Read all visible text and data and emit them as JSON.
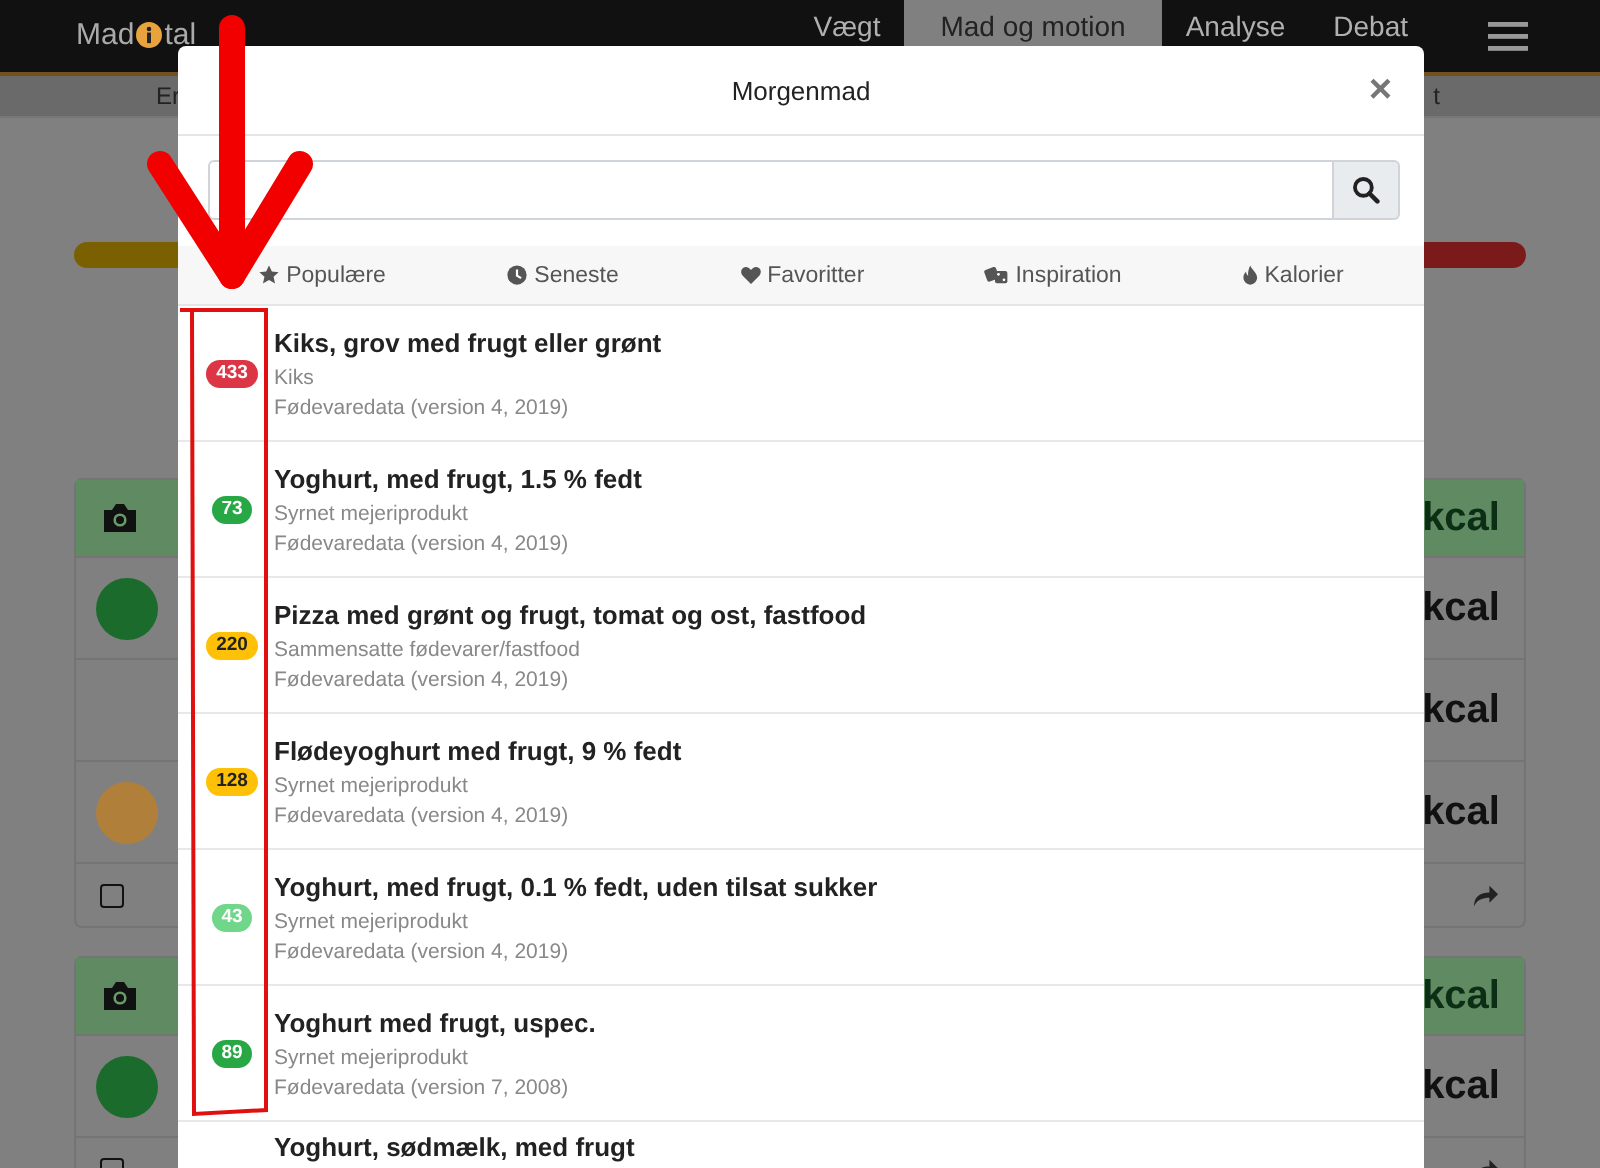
{
  "navbar": {
    "logo_left": "Mad",
    "logo_right": "tal",
    "items": [
      {
        "label": "Vægt",
        "selected": false
      },
      {
        "label": "Mad og motion",
        "selected": true
      },
      {
        "label": "Analyse",
        "selected": false
      },
      {
        "label": "Debat",
        "selected": false
      }
    ]
  },
  "subnav": {
    "left": "Er",
    "right": "t"
  },
  "cards": [
    {
      "header": "kcal",
      "checked": false,
      "rows": [
        {
          "kcal": "kcal",
          "color": "#1b6b2c"
        },
        {
          "kcal": "kcal"
        },
        {
          "kcal": "kcal",
          "color": "#b0803a"
        }
      ]
    },
    {
      "header": "kcal",
      "checked": false,
      "rows": [
        {
          "kcal": "kcal",
          "color": "#1b6b2c"
        }
      ]
    }
  ],
  "modal": {
    "title": "Morgenmad",
    "close": "×",
    "tabs": [
      {
        "label": "Populære",
        "kind": "star"
      },
      {
        "label": "Seneste",
        "kind": "clock"
      },
      {
        "label": "Favoritter",
        "kind": "heart"
      },
      {
        "label": "Inspiration",
        "kind": "dice"
      },
      {
        "label": "Kalorier",
        "kind": "flame"
      }
    ],
    "items": [
      {
        "kcal": "433",
        "color": "#dc3545",
        "name": "Kiks, grov med frugt eller grønt",
        "category": "Kiks",
        "source": "Fødevaredata (version 4, 2019)"
      },
      {
        "kcal": "73",
        "color": "#28a745",
        "name": "Yoghurt, med frugt, 1.5 % fedt",
        "category": "Syrnet mejeriprodukt",
        "source": "Fødevaredata (version 4, 2019)"
      },
      {
        "kcal": "220",
        "color": "#ffc107",
        "name": "Pizza med grønt og frugt, tomat og ost, fastfood",
        "category": "Sammensatte fødevarer/fastfood",
        "source": "Fødevaredata (version 4, 2019)"
      },
      {
        "kcal": "128",
        "color": "#ffc107",
        "name": "Flødeyoghurt med frugt, 9 % fedt",
        "category": "Syrnet mejeriprodukt",
        "source": "Fødevaredata (version 4, 2019)"
      },
      {
        "kcal": "43",
        "color": "#6fd68a",
        "name": "Yoghurt, med frugt, 0.1 % fedt, uden tilsat sukker",
        "category": "Syrnet mejeriprodukt",
        "source": "Fødevaredata (version 4, 2019)"
      },
      {
        "kcal": "89",
        "color": "#28a745",
        "name": "Yoghurt med frugt, uspec.",
        "category": "Syrnet mejeriprodukt",
        "source": "Fødevaredata (version 7, 2008)"
      },
      {
        "name": "Yoghurt, sødmælk, med frugt"
      }
    ]
  }
}
